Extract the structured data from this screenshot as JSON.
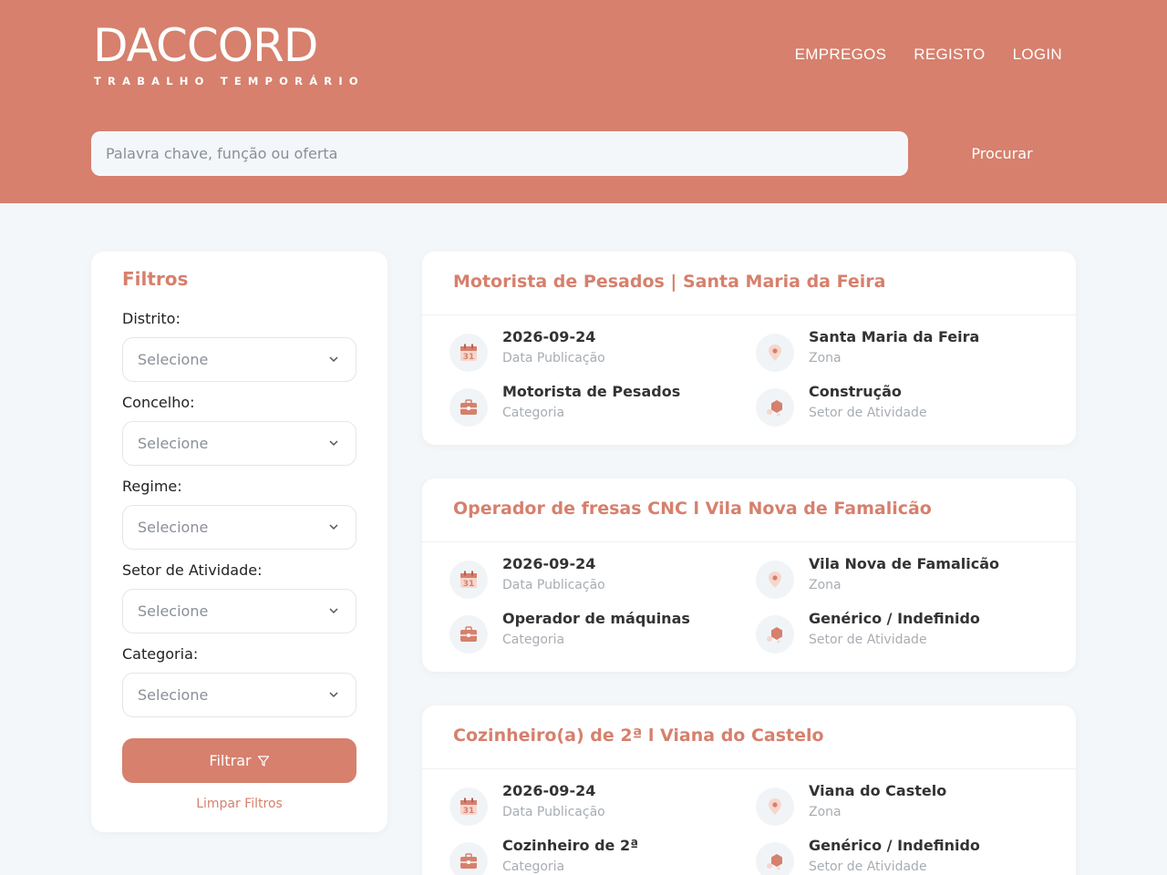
{
  "brand": {
    "name": "DACCORD",
    "tagline": "TRABALHO TEMPORÁRIO"
  },
  "nav": {
    "items": [
      "EMPREGOS",
      "REGISTO",
      "LOGIN"
    ]
  },
  "search": {
    "placeholder": "Palavra chave, função ou oferta",
    "button": "Procurar"
  },
  "filters": {
    "title": "Filtros",
    "fields": [
      {
        "label": "Distrito:",
        "value": "Selecione"
      },
      {
        "label": "Concelho:",
        "value": "Selecione"
      },
      {
        "label": "Regime:",
        "value": "Selecione"
      },
      {
        "label": "Setor de Atividade:",
        "value": "Selecione"
      },
      {
        "label": "Categoria:",
        "value": "Selecione"
      }
    ],
    "apply": "Filtrar",
    "clear": "Limpar Filtros"
  },
  "jobs": [
    {
      "title": "Motorista de Pesados | Santa Maria da Feira",
      "date": "2026-09-24",
      "date_label": "Data Publicação",
      "zone": "Santa Maria da Feira",
      "zone_label": "Zona",
      "category": "Motorista de Pesados",
      "category_label": "Categoria",
      "sector": "Construção",
      "sector_label": "Setor de Atividade"
    },
    {
      "title": "Operador de fresas CNC l Vila Nova de Famalicão",
      "date": "2026-09-24",
      "date_label": "Data Publicação",
      "zone": "Vila Nova de Famalicão",
      "zone_label": "Zona",
      "category": "Operador de máquinas",
      "category_label": "Categoria",
      "sector": "Genérico / Indefinido",
      "sector_label": "Setor de Atividade"
    },
    {
      "title": "Cozinheiro(a) de 2ª l Viana do Castelo",
      "date": "2026-09-24",
      "date_label": "Data Publicação",
      "zone": "Viana do Castelo",
      "zone_label": "Zona",
      "category": "Cozinheiro de 2ª",
      "category_label": "Categoria",
      "sector": "Genérico / Indefinido",
      "sector_label": "Setor de Atividade"
    }
  ],
  "icons": {
    "calendar_day": "31"
  },
  "colors": {
    "brand": "#d6806d",
    "background": "#f4f7f9"
  }
}
